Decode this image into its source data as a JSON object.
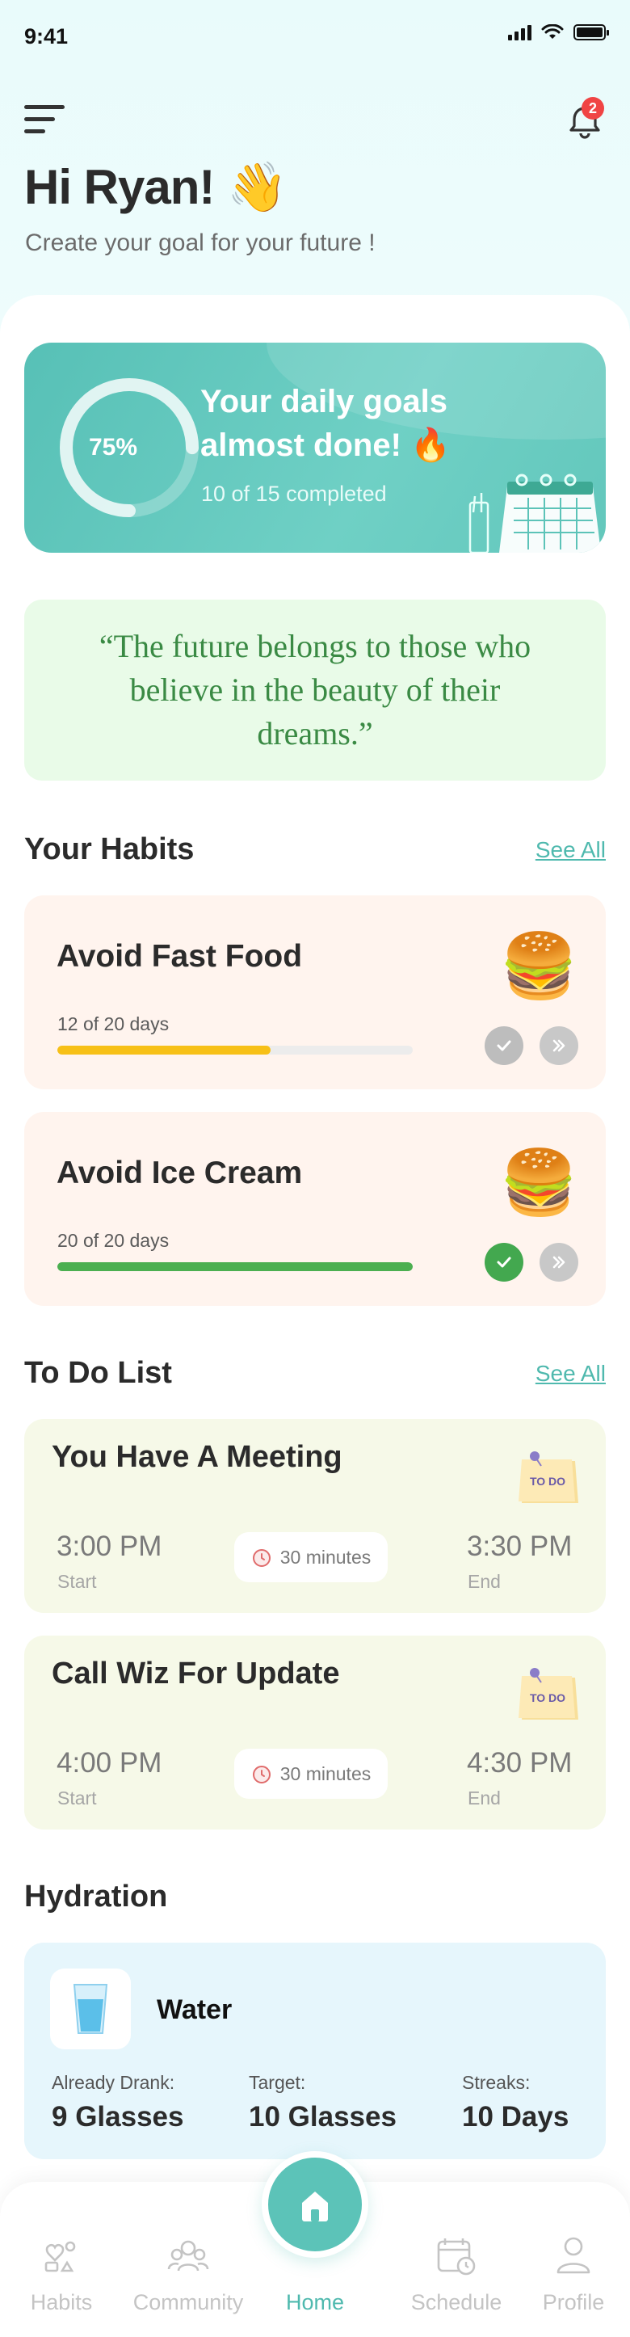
{
  "status_bar": {
    "time": "9:41"
  },
  "header": {
    "notification_count": "2",
    "greeting": "Hi Ryan! 👋",
    "subtitle": "Create your goal for your future !"
  },
  "goals": {
    "percent_label": "75%",
    "percent": 75,
    "title_line1": "Your daily goals",
    "title_line2": "almost done! 🔥",
    "completed": "10 of 15 completed"
  },
  "quote": {
    "text": "“The future belongs to those who believe in the beauty of their dreams.”"
  },
  "habits": {
    "title": "Your Habits",
    "see_all": "See All",
    "items": [
      {
        "name": "Avoid Fast Food",
        "progress_label": "12 of 20 days",
        "progress": 0.6,
        "bar_color": "#f7c017",
        "done": false,
        "icon": "burger-icon"
      },
      {
        "name": "Avoid Ice Cream",
        "progress_label": "20 of 20 days",
        "progress": 1.0,
        "bar_color": "#4caf50",
        "done": true,
        "icon": "burger-icon"
      }
    ]
  },
  "todo": {
    "title": "To Do List",
    "see_all": "See All",
    "items": [
      {
        "title": "You Have A Meeting",
        "start": "3:00 PM",
        "start_caption": "Start",
        "end": "3:30 PM",
        "end_caption": "End",
        "duration": "30 minutes",
        "note_text": "TO DO"
      },
      {
        "title": "Call Wiz For Update",
        "start": "4:00 PM",
        "start_caption": "Start",
        "end": "4:30 PM",
        "end_caption": "End",
        "duration": "30 minutes",
        "note_text": "TO DO"
      }
    ]
  },
  "hydration": {
    "title": "Hydration",
    "card_title": "Water",
    "stats": [
      {
        "label": "Already Drank:",
        "value": "9 Glasses"
      },
      {
        "label": "Target:",
        "value": "10 Glasses"
      },
      {
        "label": "Streaks:",
        "value": "10 Days"
      }
    ]
  },
  "nav": {
    "items": [
      {
        "label": "Habits",
        "icon": "habits-icon"
      },
      {
        "label": "Community",
        "icon": "community-icon"
      },
      {
        "label": "Home",
        "icon": "home-icon",
        "active": true
      },
      {
        "label": "Schedule",
        "icon": "schedule-icon"
      },
      {
        "label": "Profile",
        "icon": "profile-icon"
      }
    ]
  },
  "colors": {
    "accent": "#5cc3b8",
    "quote_text": "#3a8a44",
    "badge": "#f04444"
  }
}
